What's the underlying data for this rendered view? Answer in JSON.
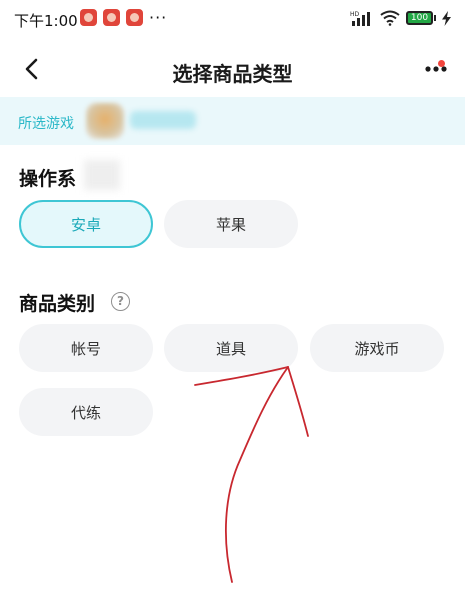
{
  "status_bar": {
    "time": "下午1:00",
    "more": "···",
    "battery": "100",
    "signal_label": "HD",
    "icons": [
      "app-badge-icon",
      "signal-icon",
      "wifi-icon",
      "battery-icon",
      "charging-icon"
    ]
  },
  "nav": {
    "title": "选择商品类型",
    "back_icon": "chevron-left-icon",
    "more_icon": "more-dots-icon",
    "badge_color": "#f2453d"
  },
  "game": {
    "label": "所选游戏"
  },
  "os_section": {
    "title": "操作系",
    "options": [
      {
        "label": "安卓",
        "selected": true
      },
      {
        "label": "苹果",
        "selected": false
      }
    ]
  },
  "category_section": {
    "title": "商品类别",
    "help": "?",
    "options": [
      {
        "label": "帐号"
      },
      {
        "label": "道具"
      },
      {
        "label": "游戏币"
      },
      {
        "label": "代练"
      }
    ]
  },
  "colors": {
    "accent": "#3ec6d4",
    "accent_text": "#1aa9b8",
    "banner_bg": "#eaf8fb",
    "chip_bg": "#f3f4f6",
    "annotation": "#c8282f"
  }
}
